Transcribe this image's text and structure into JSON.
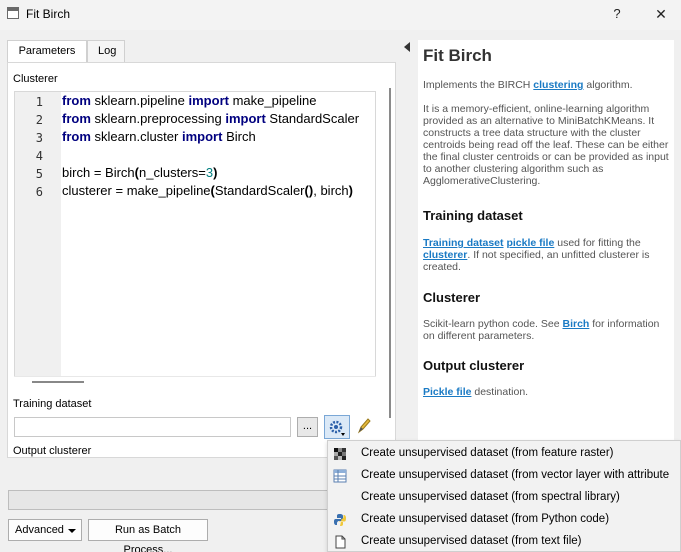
{
  "window": {
    "title": "Fit Birch",
    "help_label": "?",
    "close_label": "✕"
  },
  "tabs": [
    {
      "label": "Parameters"
    },
    {
      "label": "Log"
    }
  ],
  "clusterer": {
    "label": "Clusterer",
    "lines": [
      {
        "num": "1",
        "text": "from sklearn.pipeline import make_pipeline"
      },
      {
        "num": "2",
        "text": "from sklearn.preprocessing import StandardScaler"
      },
      {
        "num": "3",
        "text": "from sklearn.cluster import Birch"
      },
      {
        "num": "4",
        "text": ""
      },
      {
        "num": "5",
        "text": "birch = Birch(n_clusters=3)"
      },
      {
        "num": "6",
        "text": "clusterer = make_pipeline(StandardScaler(), birch)"
      }
    ]
  },
  "training_dataset": {
    "label": "Training dataset",
    "value": "",
    "browse_label": "..."
  },
  "output_clusterer": {
    "label": "Output clusterer"
  },
  "help": {
    "title": "Fit Birch",
    "intro_prefix": "Implements the BIRCH ",
    "intro_link": "clustering",
    "intro_suffix": " algorithm.",
    "description": "It is a memory-efficient, online-learning algorithm provided as an alternative to MiniBatchKMeans. It constructs a tree data structure with the cluster centroids being read off the leaf. These can be either the final cluster centroids or can be provided as input to another clustering algorithm such as AgglomerativeClustering.",
    "training_heading": "Training dataset",
    "training_link1": "Training dataset",
    "training_link2": "pickle file",
    "training_mid": " used for fitting the ",
    "training_link3": "clusterer",
    "training_suffix": ". If not specified, an unfitted clusterer is created.",
    "clusterer_heading": "Clusterer",
    "clusterer_prefix": "Scikit-learn python code. See ",
    "clusterer_link": "Birch",
    "clusterer_suffix": " for information on different parameters.",
    "output_heading": "Output clusterer",
    "output_link": "Pickle file",
    "output_suffix": " destination."
  },
  "buttons": {
    "advanced": "Advanced",
    "batch": "Run as Batch Process..."
  },
  "menu": {
    "items": [
      {
        "label": "Create unsupervised dataset (from feature raster)",
        "icon": "raster-icon"
      },
      {
        "label": "Create unsupervised dataset (from vector layer with attribute",
        "icon": "table-icon"
      },
      {
        "label": "Create unsupervised dataset (from spectral library)",
        "icon": "none"
      },
      {
        "label": "Create unsupervised dataset (from Python code)",
        "icon": "python-icon"
      },
      {
        "label": "Create unsupervised dataset (from text file)",
        "icon": "file-icon"
      }
    ]
  }
}
